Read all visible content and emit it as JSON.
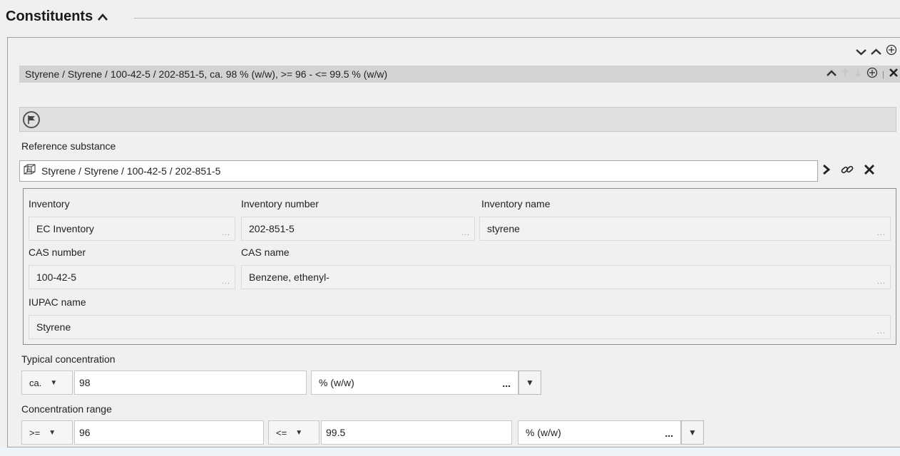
{
  "section": {
    "title": "Constituents"
  },
  "constituent_row": {
    "summary": "Styrene / Styrene / 100-42-5 / 202-851-5, ca. 98 % (w/w), >= 96 - <= 99.5 % (w/w)"
  },
  "reference_substance": {
    "label": "Reference substance",
    "value": "Styrene / Styrene / 100-42-5 / 202-851-5"
  },
  "inventory": {
    "inventory_label": "Inventory",
    "inventory_value": "EC Inventory",
    "inventory_number_label": "Inventory number",
    "inventory_number_value": "202-851-5",
    "inventory_name_label": "Inventory name",
    "inventory_name_value": "styrene",
    "cas_number_label": "CAS number",
    "cas_number_value": "100-42-5",
    "cas_name_label": "CAS name",
    "cas_name_value": "Benzene, ethenyl-",
    "iupac_name_label": "IUPAC name",
    "iupac_name_value": "Styrene",
    "ellipsis": "..."
  },
  "typical_concentration": {
    "label": "Typical concentration",
    "qualifier": "ca.",
    "value": "98",
    "unit": "% (w/w)",
    "unit_ellipsis": "..."
  },
  "concentration_range": {
    "label": "Concentration range",
    "lower_qualifier": ">=",
    "lower_value": "96",
    "upper_qualifier": "<=",
    "upper_value": "99.5",
    "unit": "% (w/w)",
    "unit_ellipsis": "..."
  },
  "icons": {
    "collapse": "chevron-up-icon",
    "expand_all": "chevron-down-icon",
    "add": "plus-circle-icon",
    "remove": "close-icon",
    "flag": "flag-icon",
    "substance": "structure-icon",
    "navigate": "chevron-right-icon",
    "link": "link-icon"
  }
}
